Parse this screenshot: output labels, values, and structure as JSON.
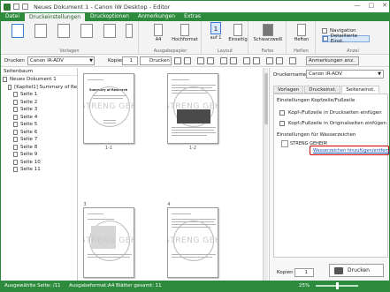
{
  "window": {
    "title": "Neues Dokument 1 - Canon iW Desktop - Editor",
    "controls": [
      "—",
      "□",
      "✕"
    ]
  },
  "menu": {
    "tabs": [
      "Datei",
      "Druckeinstellungen",
      "Druckoptionen",
      "Anmerkungen",
      "Extras"
    ],
    "active": "Druckeinstellungen"
  },
  "ribbon": {
    "groups": [
      {
        "label": "Vorlagen"
      },
      {
        "label": "Ausgabepapier"
      },
      {
        "label": "Layout"
      },
      {
        "label": "Farbe"
      },
      {
        "label": "Heften"
      },
      {
        "label": "Anzei"
      }
    ],
    "buttons": {
      "paper": "A4",
      "orientation": "Hochformat",
      "layout": "1",
      "layout_sub": "auf 1",
      "sided": "Einseitig",
      "color": "Schwarzweiß",
      "staple": "Heften",
      "nav": "Navigation",
      "detail": "Detaillierte Einst."
    }
  },
  "toolbar": {
    "printer_label": "Drucken",
    "printer_value": "Canon iR-ADV",
    "copies_label": "Kopien",
    "copies_value": "1",
    "print_btn": "Drucken",
    "annot_btn": "Anmerkungen anz."
  },
  "leftpane": {
    "header": "Seitenbaum",
    "tree": [
      {
        "label": "Neues Dokument 1",
        "indent": 0
      },
      {
        "label": "[Kapitel1] Summary of Re",
        "indent": 1
      },
      {
        "label": "Seite 1",
        "indent": 2
      },
      {
        "label": "Seite 2",
        "indent": 2
      },
      {
        "label": "Seite 3",
        "indent": 2
      },
      {
        "label": "Seite 4",
        "indent": 2
      },
      {
        "label": "Seite 5",
        "indent": 2
      },
      {
        "label": "Seite 6",
        "indent": 2
      },
      {
        "label": "Seite 7",
        "indent": 2
      },
      {
        "label": "Seite 8",
        "indent": 2
      },
      {
        "label": "Seite 9",
        "indent": 2
      },
      {
        "label": "Seite 10",
        "indent": 2
      },
      {
        "label": "Seite 11",
        "indent": 2
      }
    ]
  },
  "pages": [
    {
      "label": "1-1",
      "watermark": "STRENG GEHEIM",
      "heading": "Summary of Research"
    },
    {
      "label": "1-2",
      "watermark": "STRENG GEHEIM"
    },
    {
      "label": "3",
      "watermark": "STRENG GEHEIM"
    },
    {
      "label": "4",
      "watermark": "STRENG GEHEIM"
    }
  ],
  "rightpane": {
    "printer_label": "Druckername:",
    "printer_value": "Canon iR-ADV",
    "tabs": [
      "Vorlagen",
      "Druckeinst.",
      "Seiteneinst."
    ],
    "active_tab": "Seiteneinst.",
    "section1": "Einstellungen Kopfzeile/Fußzeile",
    "check1": "Kopf-/Fußzeile in Druckseiten einfügen",
    "check2": "Kopf-/Fußzeile in Originalseiten einfügen",
    "section2": "Einstellungen für Wasserzeichen",
    "watermark_value": "STRENG GEHEIM",
    "watermark_link": "Wasserzeichen hinzufügen/entfernen",
    "copies_label": "Kopien",
    "copies_value": "1",
    "print_btn": "Drucken"
  },
  "status": {
    "selected": "Ausgewählte Seite: /11",
    "format": "Ausgabeformat:A4",
    "sheets": "Blätter gesamt: 11",
    "zoom": "25%"
  },
  "colors": {
    "brand": "#2e8b3e",
    "highlight": "#d40000",
    "link": "#1a4fb5"
  }
}
